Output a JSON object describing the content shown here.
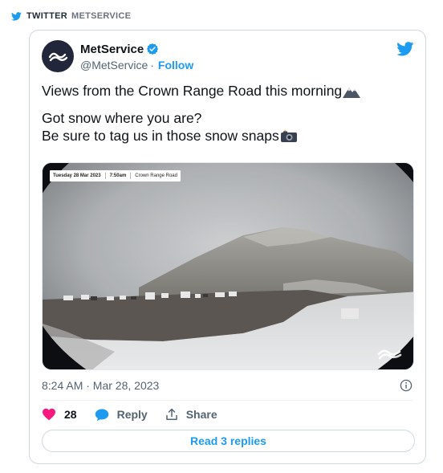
{
  "source": {
    "network": "TWITTER",
    "account": "METSERVICE",
    "brand_color": "#1d9bf0"
  },
  "tweet": {
    "display_name": "MetService",
    "handle": "@MetService",
    "separator": "·",
    "follow_label": "Follow",
    "text_lines": [
      "Views from the Crown Range Road this morning",
      "Got snow where you are?",
      "Be sure to tag us in those snow snaps"
    ],
    "emojis": [
      "snow-capped-mountain",
      "camera-with-flash"
    ],
    "media": {
      "stamp_date": "Tuesday 28 Mar 2023",
      "stamp_time": "7:50am",
      "stamp_location": "Crown Range Road"
    },
    "timestamp": "8:24 AM · Mar 28, 2023",
    "like_count": "28",
    "reply_label": "Reply",
    "share_label": "Share",
    "read_replies_label": "Read 3 replies",
    "colors": {
      "like": "#f91880",
      "accent": "#1d9bf0",
      "avatar_bg": "#21263a"
    }
  }
}
